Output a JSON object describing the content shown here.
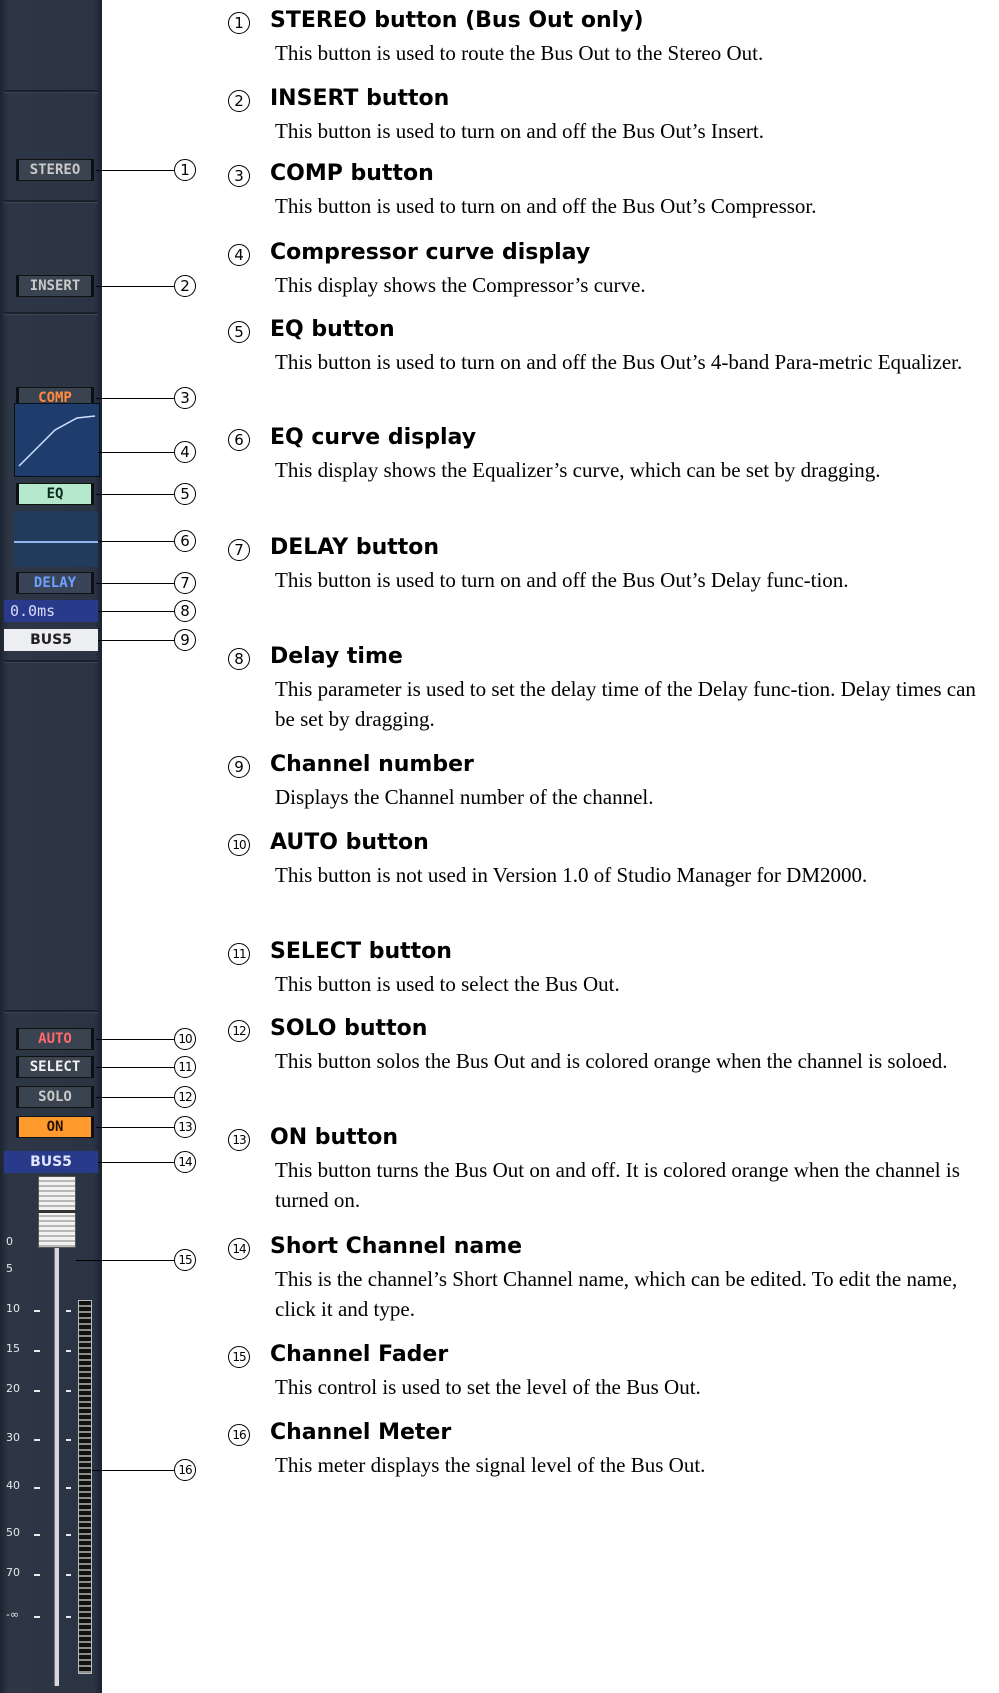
{
  "strip": {
    "buttons": {
      "stereo": "STEREO",
      "insert": "INSERT",
      "comp": "COMP",
      "eq": "EQ",
      "delay": "DELAY",
      "auto": "AUTO",
      "select": "SELECT",
      "solo": "SOLO",
      "on": "ON"
    },
    "delay_time": "0.0ms",
    "channel_number": "BUS5",
    "short_name": "BUS5",
    "fader_scale": [
      "0",
      "5",
      "10",
      "15",
      "20",
      "30",
      "40",
      "50",
      "70",
      "-∞"
    ]
  },
  "items": [
    {
      "num": "1",
      "title": "STEREO button (Bus Out only)",
      "desc": "This button is used to route the Bus Out to the Stereo Out."
    },
    {
      "num": "2",
      "title": "INSERT button",
      "desc": "This button is used to turn on and off the Bus Out’s Insert."
    },
    {
      "num": "3",
      "title": "COMP button",
      "desc": "This button is used to turn on and off the Bus Out’s Compressor."
    },
    {
      "num": "4",
      "title": "Compressor curve display",
      "desc": "This display shows the Compressor’s curve."
    },
    {
      "num": "5",
      "title": "EQ button",
      "desc": "This button is used to turn on and off the Bus Out’s 4-band Para-metric Equalizer."
    },
    {
      "num": "6",
      "title": "EQ curve display",
      "desc": "This display shows the Equalizer’s curve, which can be set by dragging."
    },
    {
      "num": "7",
      "title": "DELAY button",
      "desc": "This button is used to turn on and off the Bus Out’s Delay func-tion."
    },
    {
      "num": "8",
      "title": "Delay time",
      "desc": "This parameter is used to set the delay time of the Delay func-tion. Delay times can be set by dragging."
    },
    {
      "num": "9",
      "title": "Channel number",
      "desc": "Displays the Channel number of the channel."
    },
    {
      "num": "10",
      "title": "AUTO button",
      "desc": "This button is not used in Version 1.0 of Studio Manager for DM2000."
    },
    {
      "num": "11",
      "title": "SELECT button",
      "desc": "This button is used to select the Bus Out."
    },
    {
      "num": "12",
      "title": "SOLO button",
      "desc": "This button solos the Bus Out and is colored orange when the channel is soloed."
    },
    {
      "num": "13",
      "title": "ON button",
      "desc": "This button turns the Bus Out on and off. It is colored orange when the channel is turned on."
    },
    {
      "num": "14",
      "title": "Short Channel name",
      "desc": "This is the channel’s Short Channel name, which can be edited. To edit the name, click it and type."
    },
    {
      "num": "15",
      "title": "Channel Fader",
      "desc": "This control is used to set the level of the Bus Out."
    },
    {
      "num": "16",
      "title": "Channel Meter",
      "desc": "This meter displays the signal level of the Bus Out."
    }
  ]
}
